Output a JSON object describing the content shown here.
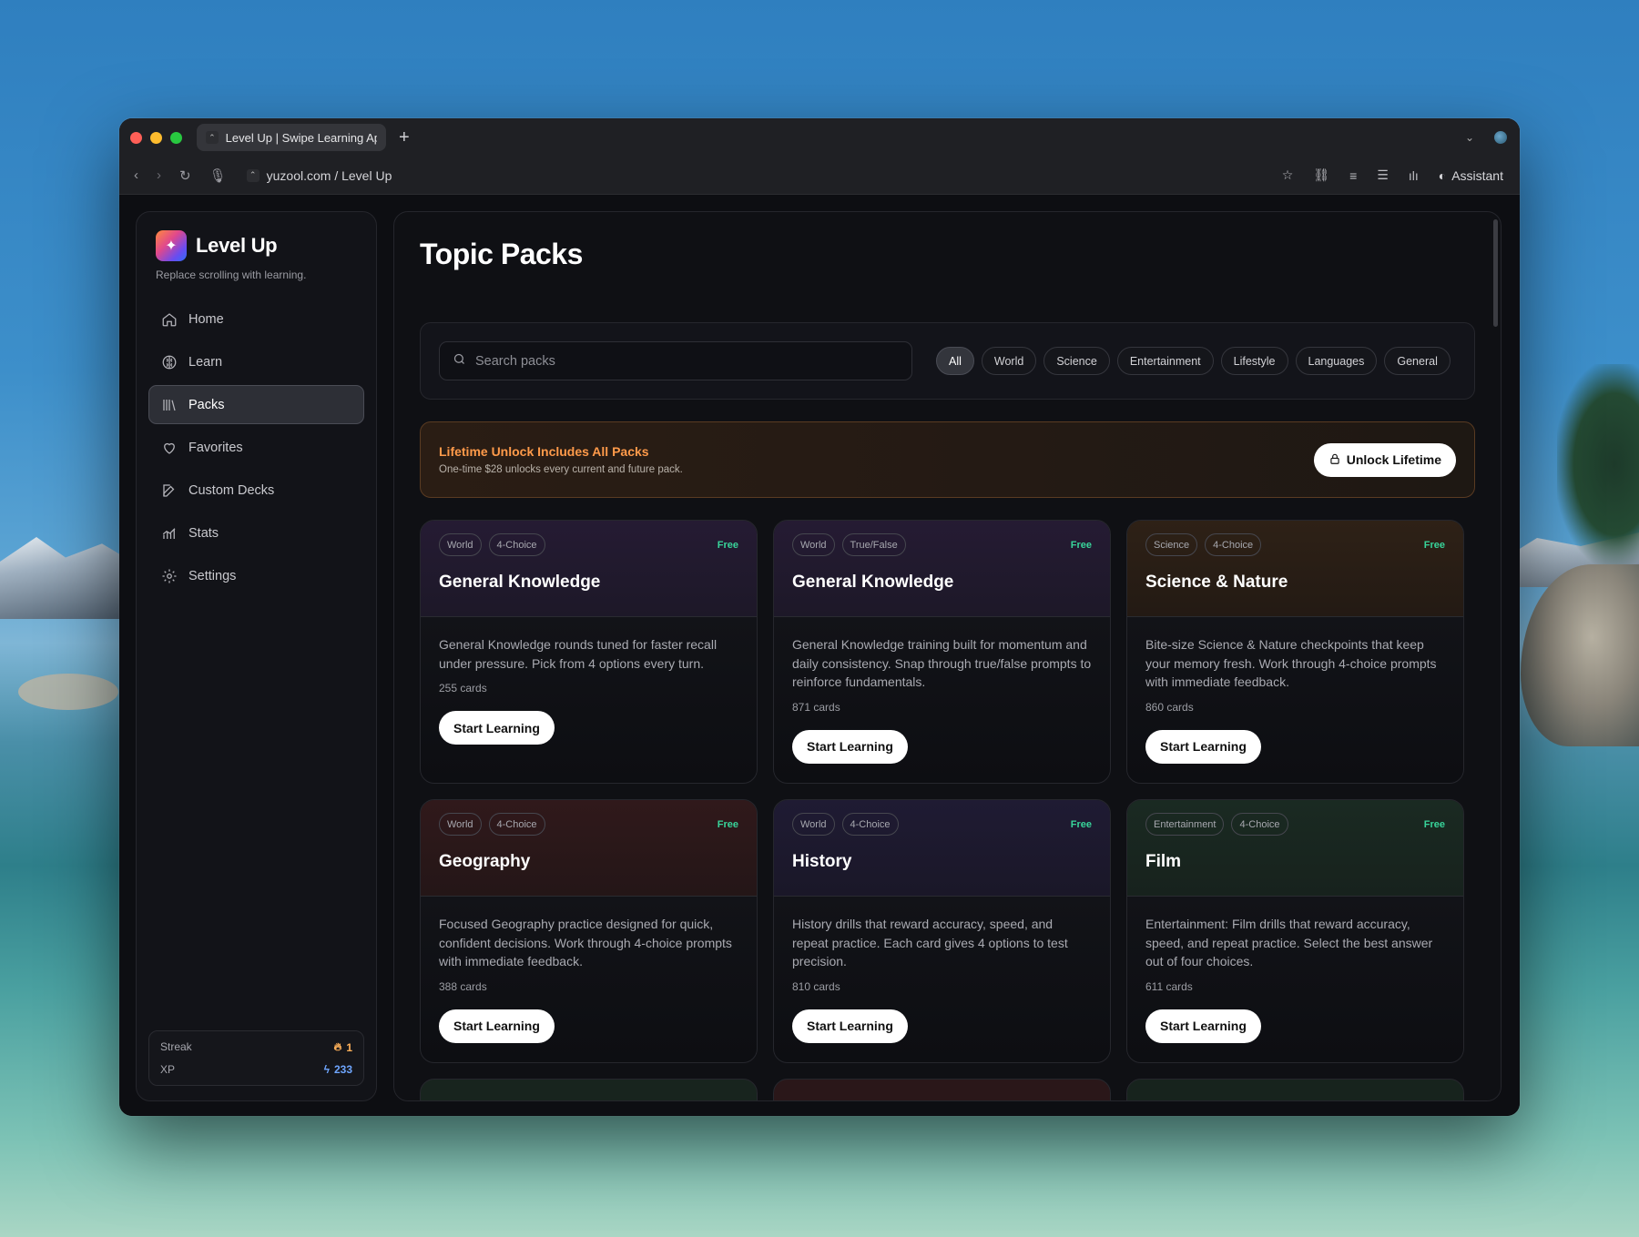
{
  "browser": {
    "tab_title": "Level Up | Swipe Learning Ap",
    "url": "yuzool.com / Level Up",
    "assistant_label": "Assistant",
    "new_tab_label": "+"
  },
  "sidebar": {
    "brand": "Level Up",
    "tagline": "Replace scrolling with learning.",
    "items": [
      {
        "label": "Home",
        "icon": "home-icon"
      },
      {
        "label": "Learn",
        "icon": "brain-icon"
      },
      {
        "label": "Packs",
        "icon": "library-icon",
        "active": true
      },
      {
        "label": "Favorites",
        "icon": "heart-icon"
      },
      {
        "label": "Custom Decks",
        "icon": "edit-icon"
      },
      {
        "label": "Stats",
        "icon": "chart-icon"
      },
      {
        "label": "Settings",
        "icon": "gear-icon"
      }
    ],
    "stats": {
      "streak_label": "Streak",
      "streak_value": "1",
      "xp_label": "XP",
      "xp_value": "233"
    }
  },
  "main": {
    "title": "Topic Packs",
    "search_placeholder": "Search packs",
    "filters": [
      "All",
      "World",
      "Science",
      "Entertainment",
      "Lifestyle",
      "Languages",
      "General"
    ],
    "active_filter": "All",
    "promo": {
      "title": "Lifetime Unlock Includes All Packs",
      "subtitle": "One-time $28 unlocks every current and future pack.",
      "button": "Unlock Lifetime"
    },
    "cards": [
      {
        "tags": [
          "World",
          "4-Choice"
        ],
        "badge": "Free",
        "title": "General Knowledge",
        "desc": "General Knowledge rounds tuned for faster recall under pressure. Pick from 4 options every turn.",
        "count": "255 cards",
        "button": "Start Learning"
      },
      {
        "tags": [
          "World",
          "True/False"
        ],
        "badge": "Free",
        "title": "General Knowledge",
        "desc": "General Knowledge training built for momentum and daily consistency. Snap through true/false prompts to reinforce fundamentals.",
        "count": "871 cards",
        "button": "Start Learning"
      },
      {
        "tags": [
          "Science",
          "4-Choice"
        ],
        "badge": "Free",
        "title": "Science & Nature",
        "desc": "Bite-size Science & Nature checkpoints that keep your memory fresh. Work through 4-choice prompts with immediate feedback.",
        "count": "860 cards",
        "button": "Start Learning"
      },
      {
        "tags": [
          "World",
          "4-Choice"
        ],
        "badge": "Free",
        "title": "Geography",
        "desc": "Focused Geography practice designed for quick, confident decisions. Work through 4-choice prompts with immediate feedback.",
        "count": "388 cards",
        "button": "Start Learning"
      },
      {
        "tags": [
          "World",
          "4-Choice"
        ],
        "badge": "Free",
        "title": "History",
        "desc": "History drills that reward accuracy, speed, and repeat practice. Each card gives 4 options to test precision.",
        "count": "810 cards",
        "button": "Start Learning"
      },
      {
        "tags": [
          "Entertainment",
          "4-Choice"
        ],
        "badge": "Free",
        "title": "Film",
        "desc": "Entertainment: Film drills that reward accuracy, speed, and repeat practice. Select the best answer out of four choices.",
        "count": "611 cards",
        "button": "Start Learning"
      }
    ]
  },
  "colors": {
    "accent_orange": "#ff9a4a",
    "free_green": "#38d49a",
    "xp_blue": "#6fa6ff"
  }
}
